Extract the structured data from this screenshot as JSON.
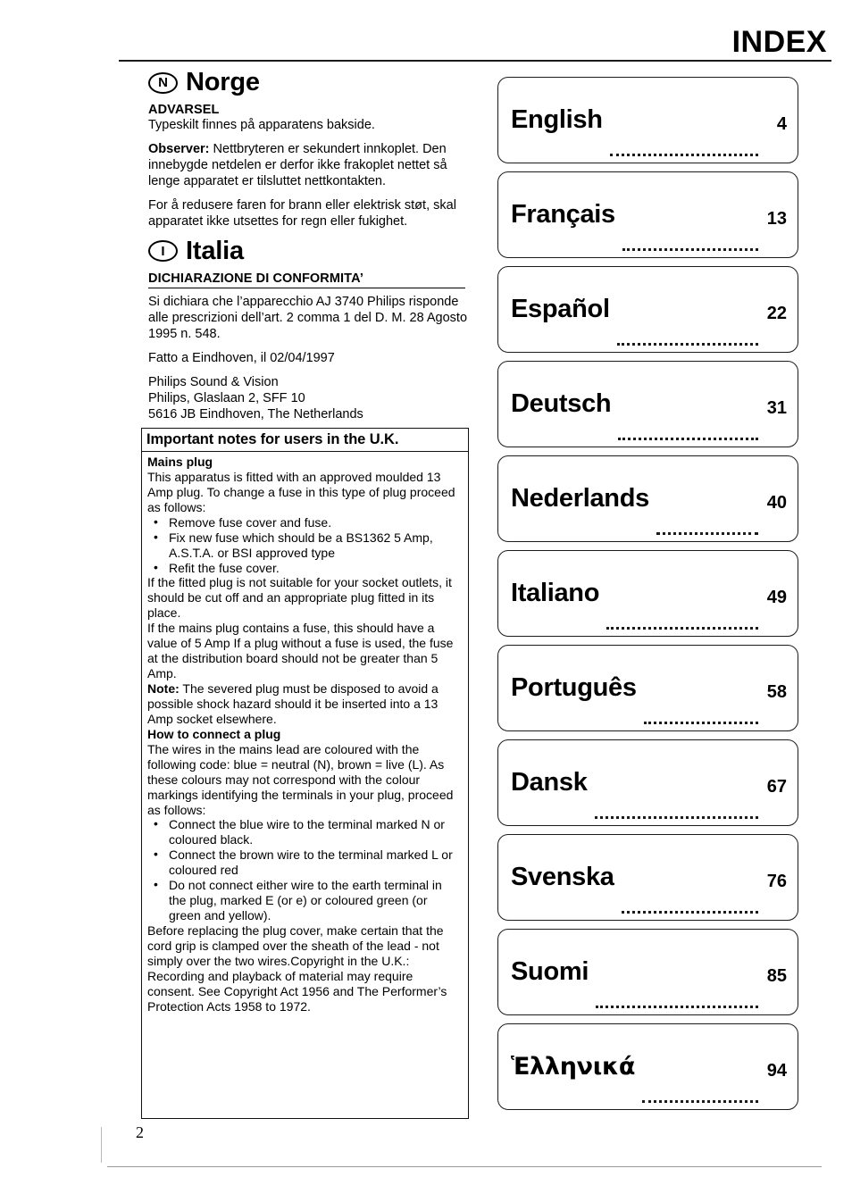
{
  "header": {
    "title": "INDEX"
  },
  "page_number": "2",
  "norge": {
    "code": "N",
    "name": "Norge",
    "warning_heading": "ADVARSEL",
    "warning_text": "Typeskilt finnes på apparatens bakside.",
    "observer_label": "Observer:",
    "observer_text": "Nettbryteren er sekundert innkoplet. Den innebygde netdelen er derfor ikke frakoplet nettet så lenge apparatet er tilsluttet nettkontakten.",
    "safety_text": "For å redusere faren for brann eller elektrisk støt, skal apparatet ikke utsettes for regn eller fukighet."
  },
  "italia": {
    "code": "I",
    "name": "Italia",
    "declaration_heading": "DICHIARAZIONE DI CONFORMITA’",
    "declaration_text": "Si dichiara che l’apparecchio AJ 3740 Philips risponde alle prescrizioni dell’art. 2 comma 1 del D. M. 28 Agosto 1995 n. 548.",
    "place_date": "Fatto a Eindhoven, il 02/04/1997",
    "address_line1": "Philips Sound & Vision",
    "address_line2": "Philips, Glaslaan 2, SFF 10",
    "address_line3": "5616 JB Eindhoven, The Netherlands"
  },
  "uk_notes": {
    "title": "Important notes for users in the U.K.",
    "mains_plug_heading": "Mains plug",
    "mains_plug_intro": "This apparatus is fitted with an approved moulded 13 Amp plug. To change a fuse in this type of plug proceed as follows:",
    "fuse_steps": [
      "Remove fuse cover and fuse.",
      "Fix new fuse which should be a BS1362 5 Amp, A.S.T.A. or BSI approved type",
      "Refit the fuse cover."
    ],
    "unsuitable_plug_text": "If the fitted plug is not suitable for your socket outlets, it should be cut off and an appropriate plug fitted in its place.",
    "fuse_value_text": "If the mains plug contains a fuse, this should have a value of 5 Amp  If a plug without a fuse is used, the fuse at the distribution board should not be greater than 5 Amp.",
    "note_label": "Note:",
    "note_text": "The severed plug must be disposed to avoid a possible shock hazard should it be inserted into a 13 Amp socket elsewhere.",
    "connect_heading": "How to connect a plug",
    "connect_intro": "The wires in the mains lead are coloured with the following code: blue = neutral (N), brown = live (L). As these colours may not correspond with the colour markings identifying the terminals in your plug, proceed as follows:",
    "connect_steps": [
      "Connect the blue wire to the terminal marked N or coloured black.",
      "Connect the brown wire to the terminal marked L or coloured red",
      "Do not connect either wire to the earth terminal in the plug, marked E (or e) or coloured green (or green and yellow)."
    ],
    "cord_grip_text": "Before replacing the plug cover, make certain that the cord grip is clamped over the sheath of the lead - not simply over the two wires.Copyright in the U.K.: Recording and playback of material may require consent. See Copyright Act 1956 and The Performer’s Protection Acts 1958 to 1972."
  },
  "index": {
    "entries": [
      {
        "language": "English",
        "page": "4"
      },
      {
        "language": "Français",
        "page": "13"
      },
      {
        "language": "Español",
        "page": "22"
      },
      {
        "language": "Deutsch",
        "page": "31"
      },
      {
        "language": "Nederlands",
        "page": "40"
      },
      {
        "language": "Italiano",
        "page": "49"
      },
      {
        "language": "Português",
        "page": "58"
      },
      {
        "language": "Dansk",
        "page": "67"
      },
      {
        "language": "Svenska",
        "page": "76"
      },
      {
        "language": "Suomi",
        "page": "85"
      },
      {
        "language": "Ἑλληνικά",
        "page": "94"
      }
    ]
  }
}
